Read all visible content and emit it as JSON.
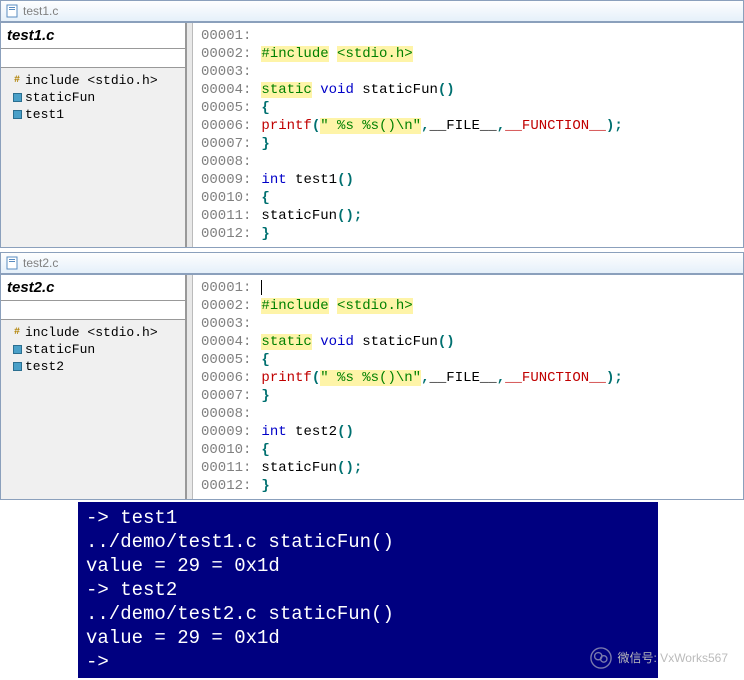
{
  "pane1": {
    "tab_title": "test1.c",
    "sidebar_title": "test1.c",
    "tree": {
      "include_item": "include <stdio.h>",
      "item1": "staticFun",
      "item2": "test1"
    },
    "lines": [
      "00001:",
      "00002:",
      "00003:",
      "00004:",
      "00005:",
      "00006:",
      "00007:",
      "00008:",
      "00009:",
      "00010:",
      "00011:",
      "00012:"
    ],
    "code": {
      "include_kw": "#include",
      "include_hdr": "<stdio.h>",
      "static_kw": "static",
      "void_kw": "void",
      "fn1_name": "staticFun",
      "fn1_parens": "()",
      "printf_name": "printf",
      "printf_fmt": "\" %s %s()\\n\"",
      "file_macro": "__FILE__",
      "func_macro": "__FUNCTION__",
      "int_kw": "int",
      "fn2_name": "test1",
      "fn2_parens": "()",
      "call_name": "staticFun",
      "brace_open": "{",
      "brace_close": "}"
    }
  },
  "pane2": {
    "tab_title": "test2.c",
    "sidebar_title": "test2.c",
    "tree": {
      "include_item": "include <stdio.h>",
      "item1": "staticFun",
      "item2": "test2"
    },
    "lines": [
      "00001:",
      "00002:",
      "00003:",
      "00004:",
      "00005:",
      "00006:",
      "00007:",
      "00008:",
      "00009:",
      "00010:",
      "00011:",
      "00012:"
    ],
    "code": {
      "include_kw": "#include",
      "include_hdr": "<stdio.h>",
      "static_kw": "static",
      "void_kw": "void",
      "fn1_name": "staticFun",
      "fn1_parens": "()",
      "printf_name": "printf",
      "printf_fmt": "\" %s %s()\\n\"",
      "file_macro": "__FILE__",
      "func_macro": "__FUNCTION__",
      "int_kw": "int",
      "fn2_name": "test2",
      "fn2_parens": "()",
      "call_name": "staticFun",
      "brace_open": "{",
      "brace_close": "}"
    }
  },
  "terminal": {
    "l1": "-> test1",
    "l2": " ../demo/test1.c staticFun()",
    "l3": "value = 29 = 0x1d",
    "l4": "-> test2",
    "l5": " ../demo/test2.c staticFun()",
    "l6": "value = 29 = 0x1d",
    "l7": "->"
  },
  "watermark": "微信号: VxWorks567"
}
